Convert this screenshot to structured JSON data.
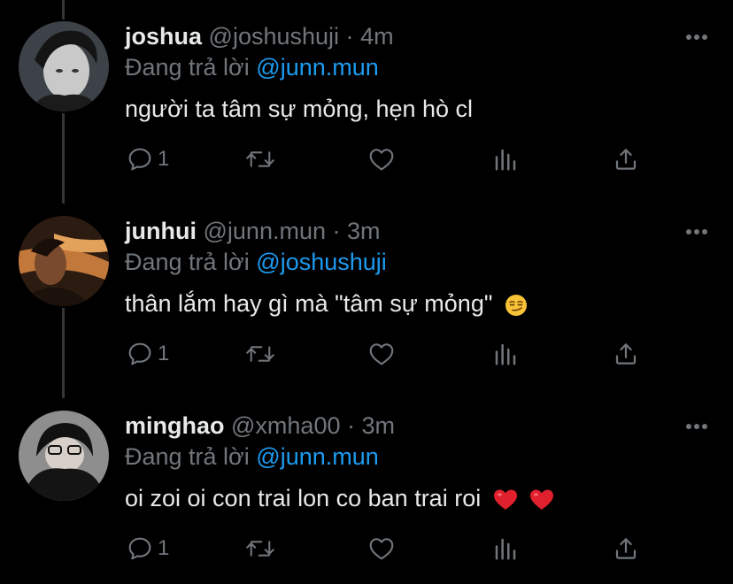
{
  "tweets": [
    {
      "name": "joshua",
      "handle": "@joshushuji",
      "separator": "·",
      "time": "4m",
      "reply_prefix": "Đang trả lời",
      "reply_to": "@junn.mun",
      "text": "người ta tâm sự mỏng, hẹn hò cl",
      "reply_count": "1"
    },
    {
      "name": "junhui",
      "handle": "@junn.mun",
      "separator": "·",
      "time": "3m",
      "reply_prefix": "Đang trả lời",
      "reply_to": "@joshushuji",
      "text": "thân lắm hay gì mà \"tâm sự mỏng\"",
      "reply_count": "1"
    },
    {
      "name": "minghao",
      "handle": "@xmha00",
      "separator": "·",
      "time": "3m",
      "reply_prefix": "Đang trả lời",
      "reply_to": "@junn.mun",
      "text": "oi zoi oi con trai lon co ban trai roi",
      "reply_count": "1"
    }
  ],
  "icons": {
    "reply": "reply-icon",
    "retweet": "retweet-icon",
    "like": "like-icon",
    "analytics": "analytics-icon",
    "share": "share-icon",
    "more": "more-icon",
    "smirk_emoji": "smirking-face-emoji",
    "heart_emoji": "red-heart-emoji"
  },
  "colors": {
    "background": "#000000",
    "primary_text": "#e7e9ea",
    "secondary_text": "#71767b",
    "link": "#1d9bf0",
    "thread_line": "#333639"
  }
}
